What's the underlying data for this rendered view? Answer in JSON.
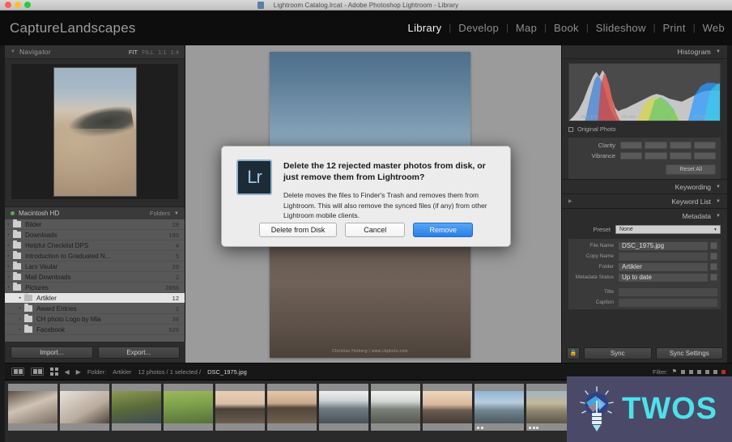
{
  "os": {
    "title": "Lightroom Catalog.lrcat - Adobe Photoshop Lightroom - Library",
    "traffic": [
      "close",
      "minimize",
      "zoom"
    ]
  },
  "topbar": {
    "identity_plate": "CaptureLandscapes",
    "modules": [
      {
        "label": "Library",
        "active": true
      },
      {
        "label": "Develop",
        "active": false
      },
      {
        "label": "Map",
        "active": false
      },
      {
        "label": "Book",
        "active": false
      },
      {
        "label": "Slideshow",
        "active": false
      },
      {
        "label": "Print",
        "active": false
      },
      {
        "label": "Web",
        "active": false
      }
    ],
    "separator": "|"
  },
  "left_panel": {
    "navigator": {
      "title": "Navigator",
      "zoom_options": [
        {
          "label": "FIT",
          "active": true
        },
        {
          "label": "FILL",
          "active": false
        },
        {
          "label": "1:1",
          "active": false
        },
        {
          "label": "1:4",
          "active": false
        }
      ]
    },
    "folders": {
      "title": "Folders",
      "volume_info": "Macintosh HD",
      "items": [
        {
          "name": "Bilder",
          "count": "28",
          "indent": 0,
          "selected": false,
          "expander": "▸"
        },
        {
          "name": "Downloads",
          "count": "195",
          "indent": 0,
          "selected": false,
          "expander": "▸"
        },
        {
          "name": "Helpful Checklist DPS",
          "count": "4",
          "indent": 0,
          "selected": false,
          "expander": "▸"
        },
        {
          "name": "Introduction to Graduated N...",
          "count": "5",
          "indent": 0,
          "selected": false,
          "expander": "▸"
        },
        {
          "name": "Lars Vaular",
          "count": "26",
          "indent": 0,
          "selected": false,
          "expander": "▸"
        },
        {
          "name": "Mail Downloads",
          "count": "2",
          "indent": 0,
          "selected": false,
          "expander": "▸"
        },
        {
          "name": "Pictures",
          "count": "2856",
          "indent": 0,
          "selected": false,
          "expander": "▾"
        },
        {
          "name": "Artikler",
          "count": "12",
          "indent": 1,
          "selected": true,
          "expander": "▸"
        },
        {
          "name": "Award Entries",
          "count": "2",
          "indent": 1,
          "selected": false,
          "expander": "▸"
        },
        {
          "name": "CH photo Logo by Mia",
          "count": "36",
          "indent": 1,
          "selected": false,
          "expander": "▸"
        },
        {
          "name": "Facebook",
          "count": "526",
          "indent": 1,
          "selected": false,
          "expander": "▸"
        }
      ]
    },
    "import_label": "Import...",
    "export_label": "Export..."
  },
  "main": {
    "photo_watermark": "Christian Hoiberg | www.cbphoto.com"
  },
  "right_panel": {
    "histogram": {
      "title": "Histogram",
      "readout": [
        "ISO 100",
        "16 mm",
        "f / 13",
        "4.0 sec"
      ]
    },
    "original_photo_label": "Original Photo",
    "quick_develop": {
      "clarity_label": "Clarity",
      "vibrance_label": "Vibrance",
      "reset_label": "Reset All"
    },
    "sections": [
      {
        "label": "Keywording"
      },
      {
        "label": "Keyword List"
      },
      {
        "label": "Metadata"
      }
    ],
    "metadata": {
      "preset_label": "Preset",
      "preset_value": "None",
      "rows": [
        {
          "key": "File Name",
          "value": "DSC_1975.jpg",
          "strong": true
        },
        {
          "key": "Copy Name",
          "value": "",
          "strong": false
        },
        {
          "key": "Folder",
          "value": "Artikler",
          "strong": true
        },
        {
          "key": "Metadata Status",
          "value": "Up to date",
          "strong": true
        },
        {
          "key": "Title",
          "value": "",
          "strong": false
        },
        {
          "key": "Caption",
          "value": "",
          "strong": false
        }
      ]
    },
    "sync_label": "Sync",
    "sync_settings_label": "Sync Settings"
  },
  "toolbar": {
    "folder_label": "Folder:",
    "folder_value": "Artikler",
    "status": "12 photos / 1 selected / ",
    "status_file": "DSC_1975.jpg",
    "status_suffix": " ▾",
    "filter_label": "Filter:",
    "stars": 5
  },
  "filmstrip": {
    "thumbnails": [
      {
        "scheme": "portrait-bride",
        "selected": false
      },
      {
        "scheme": "portrait-white",
        "selected": false
      },
      {
        "scheme": "forest-green",
        "selected": false
      },
      {
        "scheme": "forest-light",
        "selected": false
      },
      {
        "scheme": "sunset-dune",
        "selected": false
      },
      {
        "scheme": "sunset-dune2",
        "selected": false
      },
      {
        "scheme": "mountain-snow",
        "selected": false
      },
      {
        "scheme": "mountain-snow2",
        "selected": false
      },
      {
        "scheme": "sunset-hill",
        "selected": false
      },
      {
        "scheme": "coast-blue",
        "selected": false
      },
      {
        "scheme": "road-desert",
        "selected": false
      },
      {
        "scheme": "beach-rock",
        "selected": true
      }
    ]
  },
  "dialog": {
    "app_icon": "Lr",
    "title": "Delete the 12 rejected master photos from disk, or just remove them from Lightroom?",
    "message": "Delete moves the files to Finder's Trash and removes them from Lightroom.  This will also remove the synced files (if any) from other Lightroom mobile clients.",
    "buttons": [
      {
        "label": "Delete from Disk",
        "primary": false
      },
      {
        "label": "Cancel",
        "primary": false
      },
      {
        "label": "Remove",
        "primary": true
      }
    ]
  },
  "watermark": {
    "text": "TWOS",
    "accent_color": "#4de1e8",
    "background_color": "#4a4a68"
  }
}
